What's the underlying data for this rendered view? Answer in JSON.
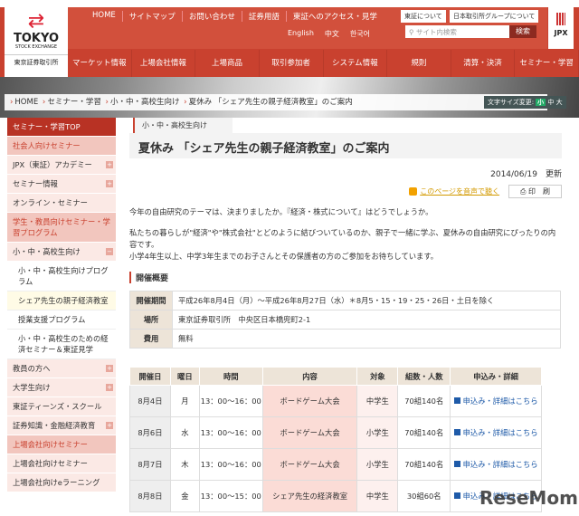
{
  "header": {
    "logo": {
      "name": "TOKYO",
      "sub": "STOCK EXCHANGE",
      "jp": "東京証券取引所"
    },
    "util_links": [
      "HOME",
      "サイトマップ",
      "お問い合わせ",
      "証券用語",
      "東証へのアクセス・見学"
    ],
    "box_links": [
      "東証について",
      "日本取引所グループについて"
    ],
    "languages": [
      "English",
      "中文",
      "한국어"
    ],
    "search_placeholder": "サイト内検索",
    "search_button": "検索",
    "jpx": "JPX",
    "nav": [
      "マーケット情報",
      "上場会社情報",
      "上場商品",
      "取引参加者",
      "システム情報",
      "規則",
      "清算・決済",
      "セミナー・学習"
    ]
  },
  "breadcrumb": [
    "HOME",
    "セミナー・学習",
    "小・中・高校生向け",
    "夏休み 「シェア先生の親子経済教室」のご案内"
  ],
  "font_size": {
    "label": "文字サイズ変更:",
    "options": [
      "小",
      "中",
      "大"
    ]
  },
  "sidebar": [
    {
      "type": "top",
      "label": "セミナー・学習TOP"
    },
    {
      "type": "sec",
      "label": "社会人向けセミナー"
    },
    {
      "type": "item",
      "label": "JPX（東証）アカデミー",
      "plus": "+"
    },
    {
      "type": "item",
      "label": "セミナー情報",
      "plus": "+"
    },
    {
      "type": "item",
      "label": "オンライン・セミナー"
    },
    {
      "type": "sec",
      "label": "学生・教員向けセミナー・学習プログラム"
    },
    {
      "type": "item",
      "label": "小・中・高校生向け",
      "plus": "−"
    },
    {
      "type": "sub",
      "label": "小・中・高校生向けプログラム"
    },
    {
      "type": "sub cur",
      "label": "シェア先生の親子経済教室"
    },
    {
      "type": "sub",
      "label": "授業支援プログラム"
    },
    {
      "type": "sub",
      "label": "小・中・高校生のための経済セミナー＆東証見学"
    },
    {
      "type": "item",
      "label": "教員の方へ",
      "plus": "+"
    },
    {
      "type": "item",
      "label": "大学生向け",
      "plus": "+"
    },
    {
      "type": "item",
      "label": "東証ティーンズ・スクール"
    },
    {
      "type": "item",
      "label": "証券知識・金融経済教育",
      "plus": "+"
    },
    {
      "type": "sec",
      "label": "上場会社向けセミナー"
    },
    {
      "type": "item",
      "label": "上場会社向けセミナー"
    },
    {
      "type": "item",
      "label": "上場会社向けeラーニング"
    }
  ],
  "main": {
    "category": "小・中・高校生向け",
    "title": "夏休み 「シェア先生の親子経済教室」のご案内",
    "date": "2014/06/19　更新",
    "listen": "このページを音声で聴く",
    "print": "印　刷",
    "p1": "今年の自由研究のテーマは、決まりましたか。『経済・株式について』はどうでしょうか。",
    "p2": "私たちの暮らしが\"経済\"や\"株式会社\"とどのように結びついているのか、親子で一緒に学ぶ、夏休みの自由研究にぴったりの内容です。",
    "p3": "小学4年生以上、中学3年生までのお子さんとその保護者の方のご参加をお待ちしています。",
    "summary_heading": "開催概要",
    "summary": [
      [
        "開催期間",
        "平成26年8月4日（月）～平成26年8月27日（水）＊8月5・15・19・25・26日・土日を除く"
      ],
      [
        "場所",
        "東京証券取引所　中央区日本橋兜町2-1"
      ],
      [
        "費用",
        "無料"
      ]
    ],
    "schedule_headers": [
      "開催日",
      "曜日",
      "時間",
      "内容",
      "対象",
      "組数・人数",
      "申込み・詳細"
    ],
    "schedule": [
      [
        "8月4日",
        "月",
        "13：00～16：00",
        "ボードゲーム大会",
        "中学生",
        "70組140名",
        "申込み・詳細はこちら"
      ],
      [
        "8月6日",
        "水",
        "13：00～16：00",
        "ボードゲーム大会",
        "小学生",
        "70組140名",
        "申込み・詳細はこちら"
      ],
      [
        "8月7日",
        "木",
        "13：00～16：00",
        "ボードゲーム大会",
        "小学生",
        "70組140名",
        "申込み・詳細はこちら"
      ],
      [
        "8月8日",
        "金",
        "13：00～15：00",
        "シェア先生の経済教室",
        "中学生",
        "30組60名",
        "申込み・詳細はこちら"
      ]
    ]
  },
  "watermark": "ReseMom"
}
